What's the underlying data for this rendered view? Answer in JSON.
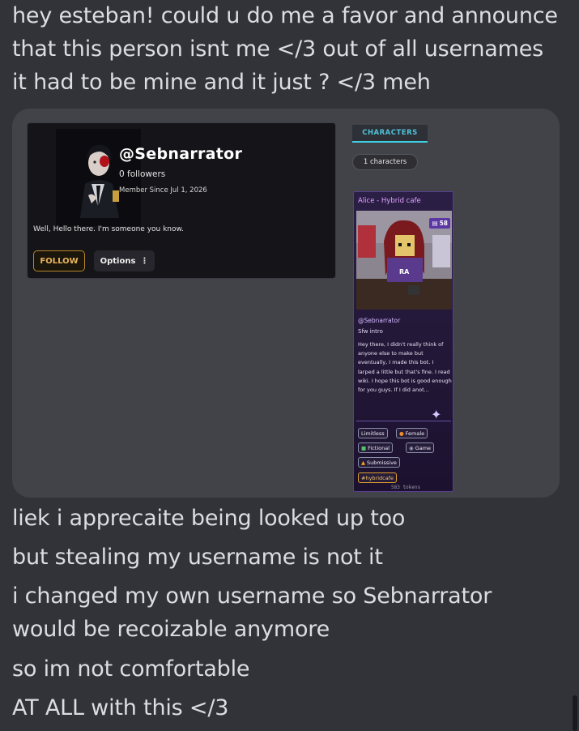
{
  "message_top": [
    "hey esteban! could u do me a favor and announce",
    "that this person isnt me </3 out of all usernames",
    "it had to be mine and it just ? </3 meh"
  ],
  "profile": {
    "username": "@Sebnarrator",
    "followers": "0 followers",
    "member_since": "Member Since Jul 1, 2026",
    "bio": "Well, Hello there. I'm someone you know.",
    "follow_label": "FOLLOW",
    "options_label": "Options",
    "options_icon": "vertical-dots-icon"
  },
  "characters": {
    "tab_label": "CHARACTERS",
    "count_label": "1 characters",
    "card": {
      "title": "Alice - Hybrid cafe",
      "message_count": "58",
      "creator": "@Sebnarrator",
      "subtitle": "Sfw intro",
      "description": "Hey there, I didn't really think of anyone else to make but eventually, I made this bot. I larped a little but that's fine. I read wiki. I hope this bot is good enough for you guys. If I did anot...",
      "tags": [
        {
          "label": "Limitless",
          "icon": ""
        },
        {
          "label": "Female",
          "icon": "orange-circle-icon"
        },
        {
          "label": "Fictional",
          "icon": "green-icon"
        },
        {
          "label": "Game",
          "icon": "gamepad-icon"
        },
        {
          "label": "Submissive",
          "icon": "warning-icon"
        },
        {
          "label": "#hybridcafe",
          "icon": ""
        }
      ],
      "tokens": "583 tokens"
    }
  },
  "message_bottom": [
    "liek i apprecaite being looked up too",
    "but stealing my username is not it",
    "i changed my own username so Sebnarrator",
    "would be recoizable anymore",
    "so im not comfortable",
    "AT ALL with this </3"
  ],
  "colors": {
    "background": "#323339",
    "embed_background": "#424348",
    "accent_cyan": "#3fd0e4",
    "accent_gold": "#b8862e",
    "card_purple": "#2b1f46"
  }
}
